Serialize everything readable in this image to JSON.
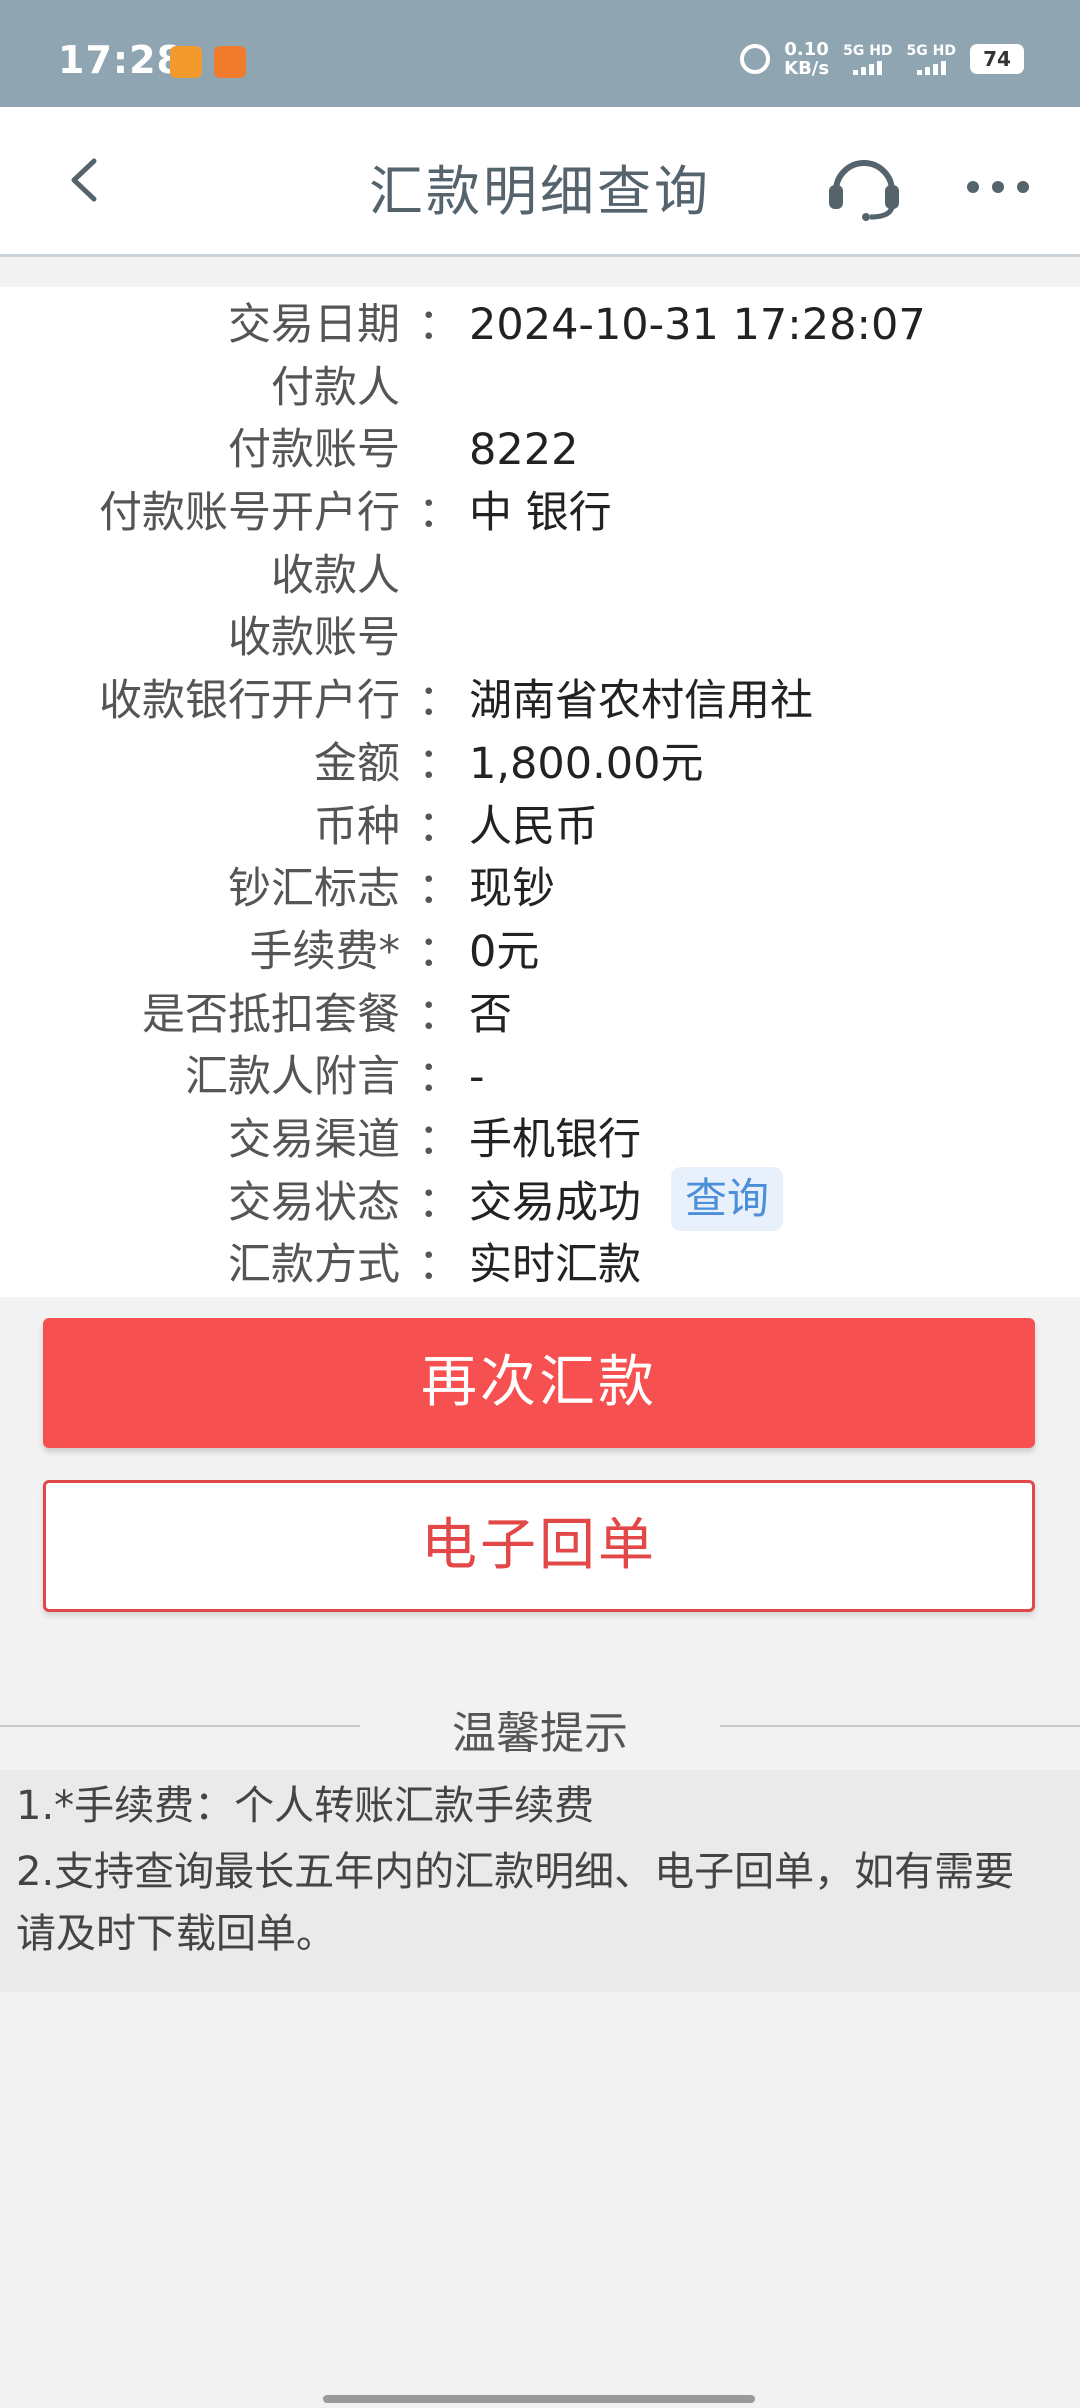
{
  "status_bar": {
    "time": "17:28",
    "net_speed_value": "0.10",
    "net_speed_unit": "KB/s",
    "sim1": "5G HD",
    "sim2": "5G HD",
    "battery": "74"
  },
  "header": {
    "title": "汇款明细查询"
  },
  "details": [
    {
      "label": "交易日期",
      "value": "2024-10-31 17:28:07"
    },
    {
      "label": "付款人",
      "value": ""
    },
    {
      "label": "付款账号",
      "value": "8222"
    },
    {
      "label": "付款账号开户行",
      "value": "中 银行"
    },
    {
      "label": "收款人",
      "value": ""
    },
    {
      "label": "收款账号",
      "value": ""
    },
    {
      "label": "收款银行开户行",
      "value": "湖南省农村信用社"
    },
    {
      "label": "金额",
      "value": "1,800.00元"
    },
    {
      "label": "币种",
      "value": "人民币"
    },
    {
      "label": "钞汇标志",
      "value": "现钞"
    },
    {
      "label": "手续费*",
      "value": "0元"
    },
    {
      "label": "是否抵扣套餐",
      "value": "否"
    },
    {
      "label": "汇款人附言",
      "value": "-"
    },
    {
      "label": "交易渠道",
      "value": "手机银行"
    },
    {
      "label": "交易状态",
      "value": "交易成功"
    },
    {
      "label": "汇款方式",
      "value": "实时汇款"
    }
  ],
  "colon": "：",
  "query_link": "查询",
  "buttons": {
    "remit_again": "再次汇款",
    "e_receipt": "电子回单"
  },
  "tips": {
    "title": "温馨提示",
    "line1": "1.*手续费：个人转账汇款手续费",
    "line2a": "2.支持查询最长五年内的汇款明细、电子回单，如有需要",
    "line2b": "请及时下载回单。"
  },
  "colors": {
    "primary_red": "#f75050",
    "status_bar": "#8fa5b2",
    "link_blue": "#4a8fd8"
  }
}
